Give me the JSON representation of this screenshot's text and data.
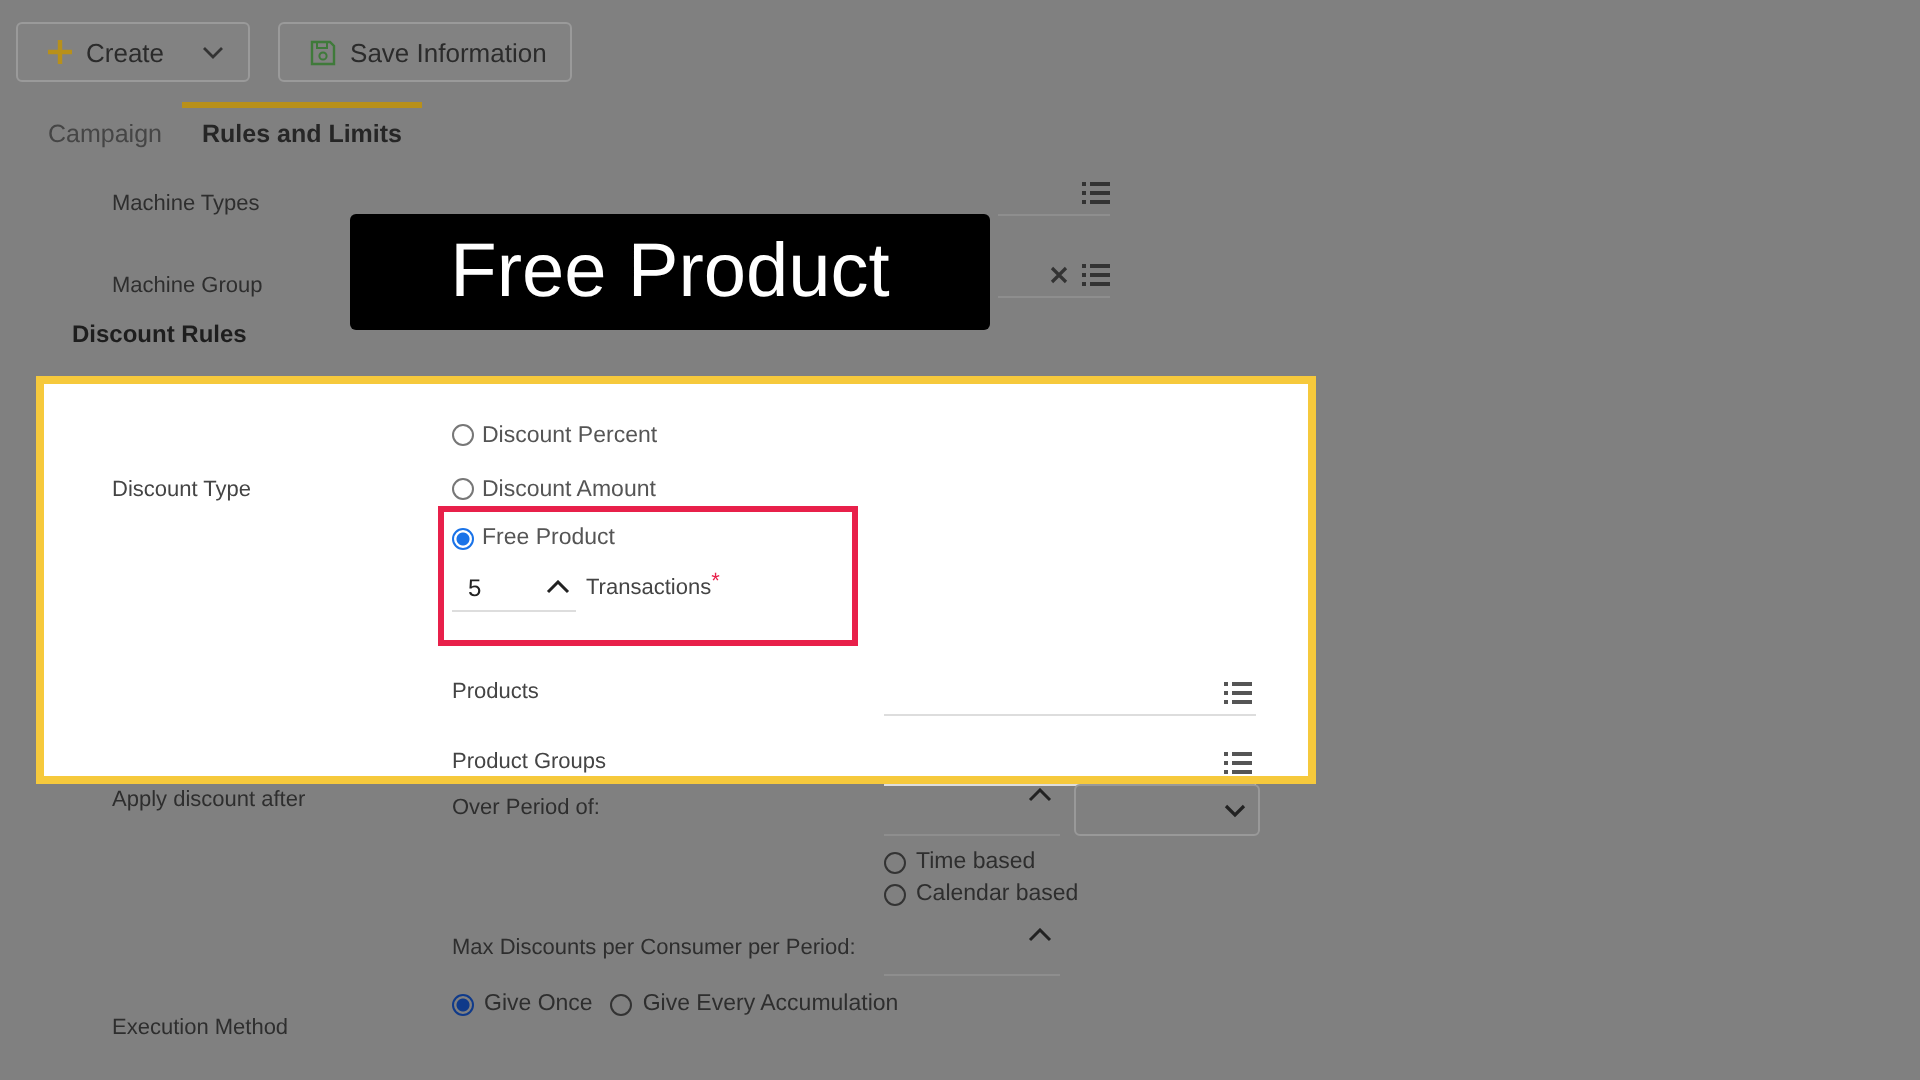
{
  "toolbar": {
    "buttons": [
      {
        "label": "Create",
        "kind": "create"
      },
      {
        "label": "Save Information",
        "kind": "save"
      }
    ]
  },
  "tabs": [
    {
      "label": "Campaign",
      "selected": false
    },
    {
      "label": "Rules and Limits",
      "selected": true
    }
  ],
  "machine_fields": [
    {
      "label": "Machine Types",
      "clearable": false
    },
    {
      "label": "Machine Group",
      "clearable": true
    }
  ],
  "section_title": "Discount Rules",
  "discount_type": {
    "label": "Discount Type",
    "options": [
      {
        "label": "Discount Percent",
        "selected": false
      },
      {
        "label": "Discount Amount",
        "selected": false
      },
      {
        "label": "Free Product",
        "selected": true
      }
    ],
    "transactions": {
      "value": "5",
      "label": "Transactions",
      "required_mark": "*"
    }
  },
  "product_fields": [
    {
      "label": "Products"
    },
    {
      "label": "Product Groups"
    }
  ],
  "apply_after": {
    "label": "Apply discount after",
    "period_label": "Over Period of:",
    "period_basis": [
      {
        "label": "Time based",
        "selected": false
      },
      {
        "label": "Calendar based",
        "selected": false
      }
    ],
    "max_label": "Max Discounts per Consumer per Period:"
  },
  "execution": {
    "label": "Execution Method",
    "options": [
      {
        "label": "Give Once",
        "selected": true
      },
      {
        "label": "Give Every Accumulation",
        "selected": false
      }
    ]
  },
  "caption": "Free Product"
}
